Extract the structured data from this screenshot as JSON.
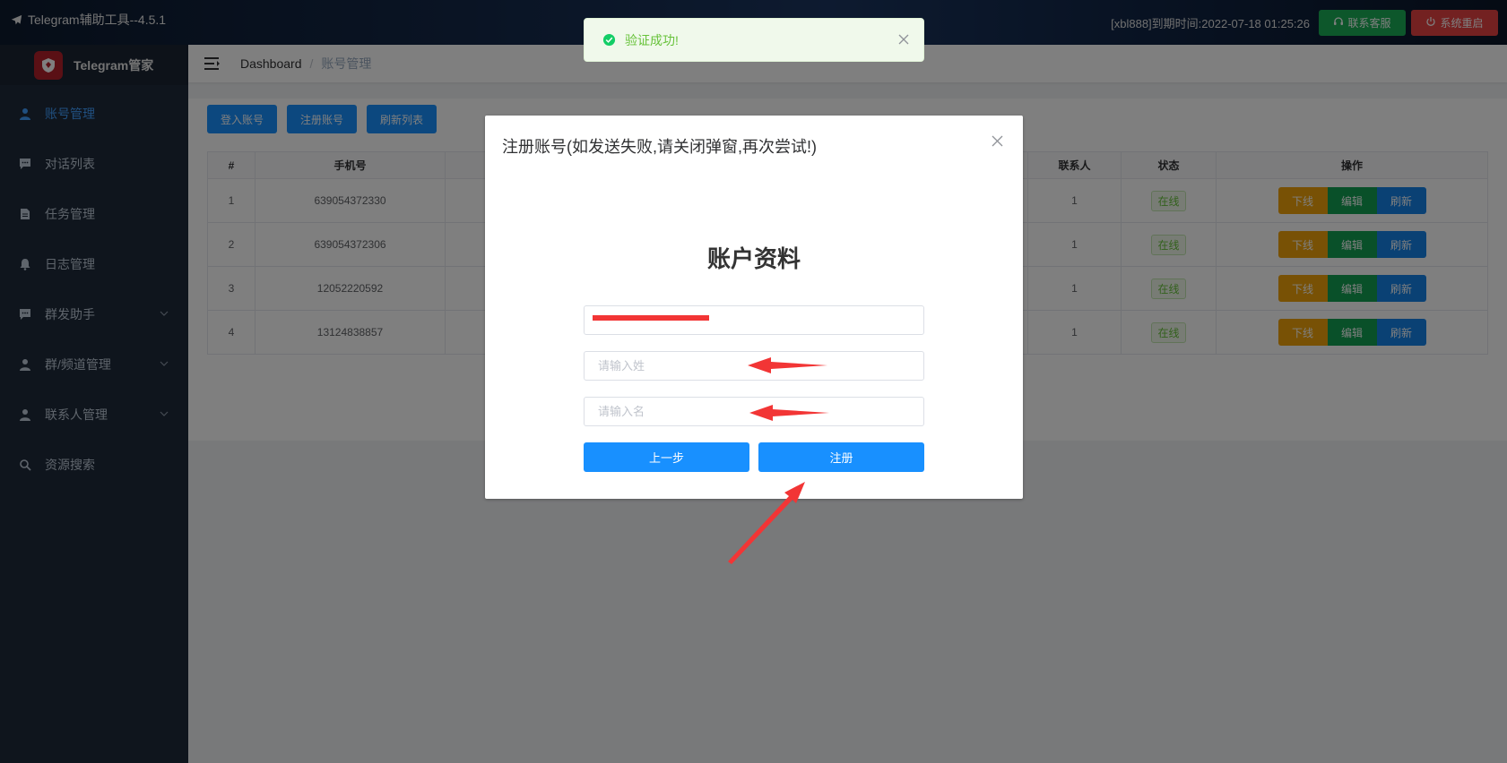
{
  "app": {
    "title": "Telegram辅助工具--4.5.1",
    "expire_text": "[xbl888]到期时间:2022-07-18 01:25:26",
    "contact_label": "联系客服",
    "restart_label": "系统重启",
    "logo_text": "Telegram管家"
  },
  "sidebar": {
    "items": [
      {
        "label": "账号管理",
        "icon": "user-icon",
        "active": true
      },
      {
        "label": "对话列表",
        "icon": "chat-icon"
      },
      {
        "label": "任务管理",
        "icon": "document-icon"
      },
      {
        "label": "日志管理",
        "icon": "bell-icon"
      },
      {
        "label": "群发助手",
        "icon": "chat-icon",
        "expandable": true
      },
      {
        "label": "群/频道管理",
        "icon": "user-icon",
        "expandable": true
      },
      {
        "label": "联系人管理",
        "icon": "user-icon",
        "expandable": true
      },
      {
        "label": "资源搜索",
        "icon": "search-icon"
      }
    ]
  },
  "breadcrumb": {
    "root": "Dashboard",
    "current": "账号管理"
  },
  "toolbar": {
    "login_label": "登入账号",
    "register_label": "注册账号",
    "refresh_label": "刷新列表"
  },
  "table": {
    "headers": {
      "index": "#",
      "phone": "手机号",
      "contacts": "联系人",
      "status": "状态",
      "actions": "操作"
    },
    "rows": [
      {
        "index": "1",
        "phone": "639054372330",
        "contacts": "1",
        "status": "在线"
      },
      {
        "index": "2",
        "phone": "639054372306",
        "contacts": "1",
        "status": "在线"
      },
      {
        "index": "3",
        "phone": "12052220592",
        "contacts": "1",
        "status": "在线"
      },
      {
        "index": "4",
        "phone": "13124838857",
        "contacts": "1",
        "status": "在线"
      }
    ],
    "action_labels": {
      "offline": "下线",
      "edit": "编辑",
      "refresh": "刷新"
    }
  },
  "notification": {
    "text": "验证成功!"
  },
  "dialog": {
    "title": "注册账号(如发送失败,请关闭弹窗,再次尝试!)",
    "heading": "账户资料",
    "last_name_placeholder": "请输入姓",
    "first_name_placeholder": "请输入名",
    "prev_label": "上一步",
    "register_label": "注册"
  },
  "colors": {
    "primary": "#1890ff",
    "success": "#67c23a",
    "danger": "#e64242",
    "warning": "#f0a30a",
    "sidebar": "#1e2a3a"
  }
}
